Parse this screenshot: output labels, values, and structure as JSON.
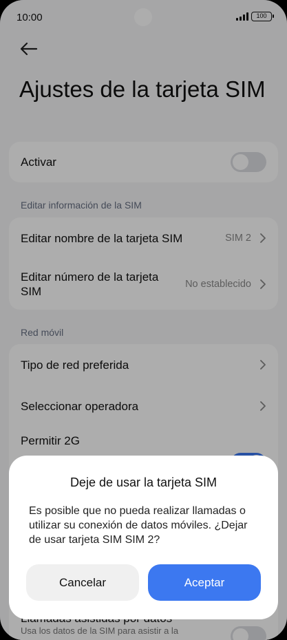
{
  "status_bar": {
    "time": "10:00",
    "battery": "100"
  },
  "page": {
    "title": "Ajustes de la tarjeta SIM"
  },
  "activate": {
    "label": "Activar",
    "enabled": false
  },
  "sim_info": {
    "header": "Editar información de la SIM",
    "items": [
      {
        "label": "Editar nombre de la tarjeta SIM",
        "value": "SIM 2"
      },
      {
        "label": "Editar número de la tarjeta SIM",
        "value": "No establecido"
      }
    ]
  },
  "mobile_network": {
    "header": "Red móvil",
    "items": [
      {
        "label": "Tipo de red preferida"
      },
      {
        "label": "Seleccionar operadora"
      },
      {
        "label": "Permitir 2G",
        "enabled": true
      }
    ]
  },
  "data_assisted_calls": {
    "label": "Llamadas asistidas por datos",
    "subtitle": "Usa los datos de la SIM para asistir a la",
    "enabled": false
  },
  "dialog": {
    "title": "Deje de usar la tarjeta SIM",
    "message": "Es posible que no pueda realizar llamadas o utilizar su conexión de datos móviles. ¿Dejar de usar tarjeta SIM SIM 2?",
    "cancel_label": "Cancelar",
    "accept_label": "Aceptar"
  },
  "colors": {
    "accent": "#3c78f0",
    "background": "#f5f5f7"
  }
}
